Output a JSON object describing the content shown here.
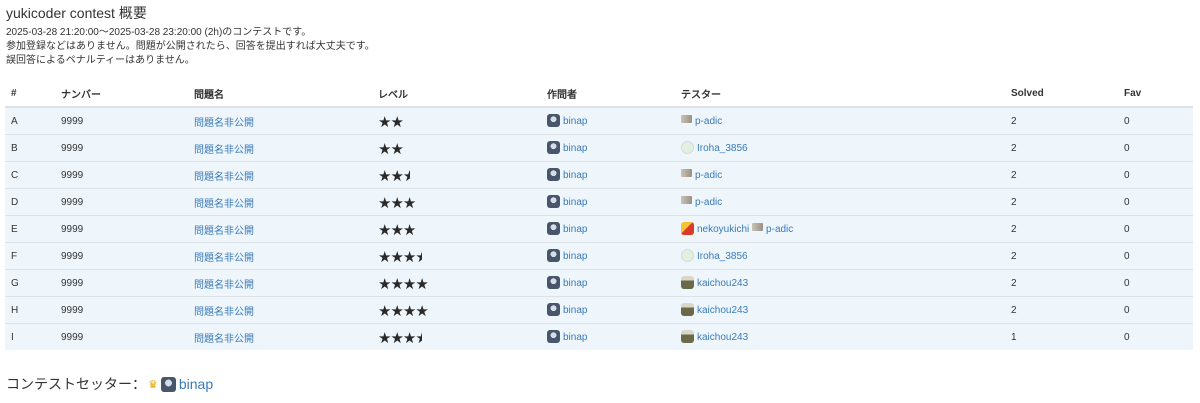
{
  "contest": {
    "title": "yukicoder contest 概要",
    "period": "2025-03-28 21:20:00～2025-03-28 23:20:00 (2h)のコンテストです。",
    "note1": "参加登録などはありません。問題が公開されたら、回答を提出すれば大丈夫です。",
    "note2": "誤回答によるペナルティーはありません。"
  },
  "table": {
    "headers": [
      "#",
      "ナンバー",
      "問題名",
      "レベル",
      "作問者",
      "テスター",
      "Solved",
      "Fav"
    ],
    "rows": [
      {
        "id": "A",
        "number": "9999",
        "name": "問題名非公開",
        "stars": "★★",
        "half": "",
        "author": "binap",
        "testers": [
          {
            "name": "p-adic",
            "avatar": "padic"
          }
        ],
        "solved": "2",
        "fav": "0"
      },
      {
        "id": "B",
        "number": "9999",
        "name": "問題名非公開",
        "stars": "★★",
        "half": "",
        "author": "binap",
        "testers": [
          {
            "name": "Iroha_3856",
            "avatar": "iroha"
          }
        ],
        "solved": "2",
        "fav": "0"
      },
      {
        "id": "C",
        "number": "9999",
        "name": "問題名非公開",
        "stars": "★★",
        "half": "★",
        "author": "binap",
        "testers": [
          {
            "name": "p-adic",
            "avatar": "padic"
          }
        ],
        "solved": "2",
        "fav": "0"
      },
      {
        "id": "D",
        "number": "9999",
        "name": "問題名非公開",
        "stars": "★★★",
        "half": "",
        "author": "binap",
        "testers": [
          {
            "name": "p-adic",
            "avatar": "padic"
          }
        ],
        "solved": "2",
        "fav": "0"
      },
      {
        "id": "E",
        "number": "9999",
        "name": "問題名非公開",
        "stars": "★★★",
        "half": "",
        "author": "binap",
        "testers": [
          {
            "name": "nekoyukichi",
            "avatar": "neko"
          },
          {
            "name": "p-adic",
            "avatar": "padic"
          }
        ],
        "solved": "2",
        "fav": "0"
      },
      {
        "id": "F",
        "number": "9999",
        "name": "問題名非公開",
        "stars": "★★★",
        "half": "★",
        "author": "binap",
        "testers": [
          {
            "name": "Iroha_3856",
            "avatar": "iroha"
          }
        ],
        "solved": "2",
        "fav": "0"
      },
      {
        "id": "G",
        "number": "9999",
        "name": "問題名非公開",
        "stars": "★★★★",
        "half": "",
        "author": "binap",
        "testers": [
          {
            "name": "kaichou243",
            "avatar": "kai"
          }
        ],
        "solved": "2",
        "fav": "0"
      },
      {
        "id": "H",
        "number": "9999",
        "name": "問題名非公開",
        "stars": "★★★★",
        "half": "",
        "author": "binap",
        "testers": [
          {
            "name": "kaichou243",
            "avatar": "kai"
          }
        ],
        "solved": "2",
        "fav": "0"
      },
      {
        "id": "I",
        "number": "9999",
        "name": "問題名非公開",
        "stars": "★★★",
        "half": "★",
        "author": "binap",
        "testers": [
          {
            "name": "kaichou243",
            "avatar": "kai"
          }
        ],
        "solved": "1",
        "fav": "0"
      }
    ]
  },
  "setter": {
    "label": "コンテストセッター：",
    "name": "binap",
    "icon": "crown-icon"
  }
}
